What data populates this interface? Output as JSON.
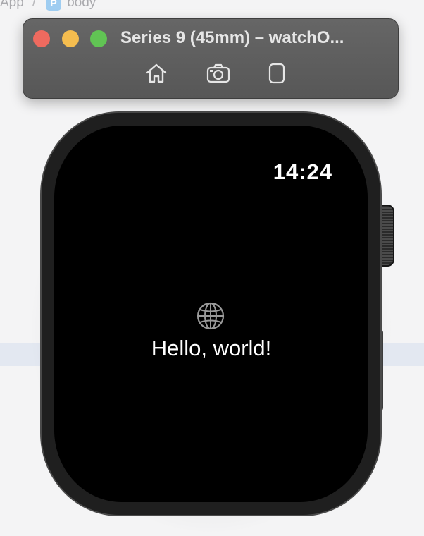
{
  "background": {
    "breadcrumb_left": "App",
    "breadcrumb_separator": "/",
    "breadcrumb_icon_letter": "P",
    "breadcrumb_item": "body"
  },
  "simulator": {
    "title": "Series 9 (45mm) – watchO...",
    "toolbar": {
      "home_icon": "home-icon",
      "screenshot_icon": "camera-icon",
      "rotate_icon": "device-rotate-icon"
    },
    "colors": {
      "close": "#ee6a5f",
      "minimize": "#f5bd4f",
      "zoom": "#61c454"
    }
  },
  "watch": {
    "time": "14:24",
    "icon": "globe-icon",
    "message": "Hello, world!"
  }
}
